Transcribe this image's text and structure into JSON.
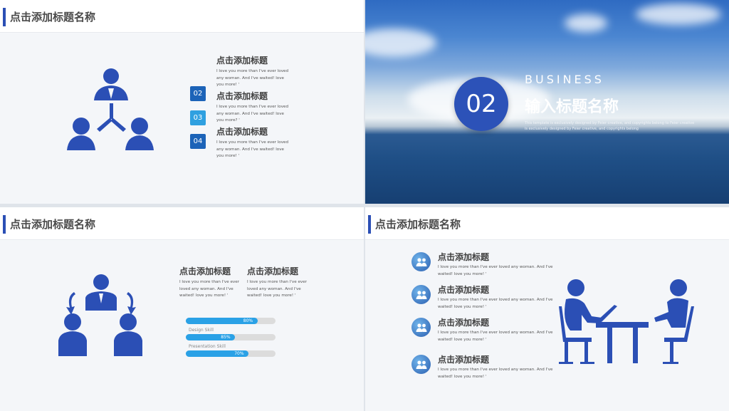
{
  "slide1": {
    "header": "点击添加标题名称",
    "items": [
      {
        "num": "",
        "title": "点击添加标题",
        "text": "I love you more than I've ever loved\nany woman. And I've waited! love\nyou more! '"
      },
      {
        "num": "02",
        "title": "点击添加标题",
        "text": "I love you more than I've ever loved\nany woman. And I've waited! love\nyou more? '"
      },
      {
        "num": "03",
        "title": "点击添加标题",
        "text": "I love you more than I've ever loved\nany woman. And I've waited! love\nyou more? '"
      },
      {
        "num": "04",
        "title": "",
        "text": ""
      }
    ],
    "item3": {
      "title": "点击添加标题",
      "text": "I love you more than I've ever loved\nany woman. And I've waited! love\nyou more! '"
    }
  },
  "slide2": {
    "number": "02",
    "business": "BUSINESS",
    "title": "输入标题名称",
    "text": "This template is exclusively designed by Feier creative, and copyrights belong to Feier creative\nis exclusively designed by Feier creative, and copyrights belong"
  },
  "slide3": {
    "header": "点击添加标题名称",
    "col1": {
      "title": "点击添加标题",
      "text": "I love you more than I've ever\nloved any woman. And I've\nwaited! love you more! '"
    },
    "col2": {
      "title": "点击添加标题",
      "text": "I love you more than I've ever\nloved any woman. And I've\nwaited! love you more! '"
    },
    "skills": [
      {
        "label": "",
        "value_text": "80%",
        "value": 0.8
      },
      {
        "label": "Design Skill",
        "value_text": "85%",
        "value": 0.55
      },
      {
        "label": "Presentation Skill",
        "value_text": "70%",
        "value": 0.7
      }
    ]
  },
  "slide4": {
    "header": "点击添加标题名称",
    "items": [
      {
        "title": "点击添加标题",
        "text": "I love you more than I've ever loved any woman. And I've\nwaited! love you more! '"
      },
      {
        "title": "点击添加标题",
        "text": "I love you more than I've ever loved any woman. And I've\nwaited! love you more! '"
      },
      {
        "title": "点击添加标题",
        "text": "I love you more than I've ever loved any woman. And I've\nwaited! love you more! '"
      },
      {
        "title": "点击添加标题",
        "text": "I love you more than I've ever loved any woman. And I've\nwaited! love you more! '"
      }
    ]
  },
  "colors": {
    "accent": "#2b4fb5",
    "icon": "#2b4fb5",
    "progress": "#2aa1e6"
  }
}
